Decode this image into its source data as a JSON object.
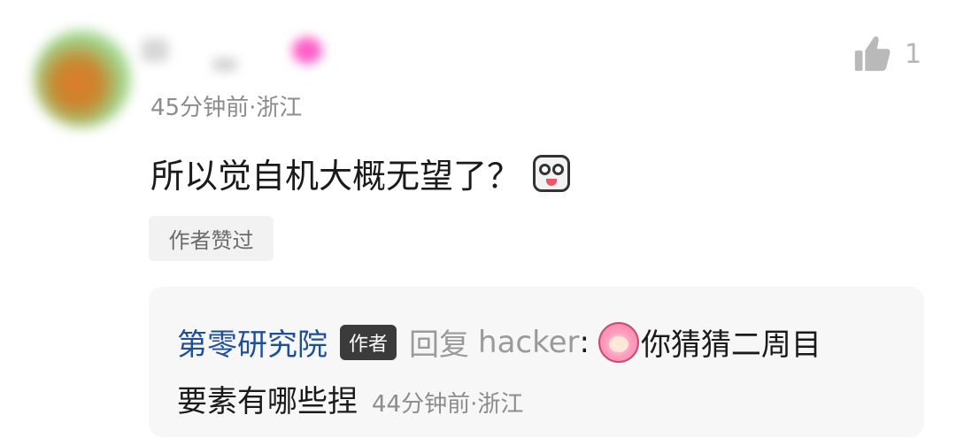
{
  "comment": {
    "meta": "45分钟前·浙江",
    "text": "所以觉自机大概无望了？",
    "like_count": "1",
    "author_liked_tag": "作者赞过"
  },
  "reply": {
    "author": "第零研究院",
    "badge": "作者",
    "reply_word": "回复",
    "target_user": "hacker",
    "colon": ":",
    "text_line1": "你猜猜二周目",
    "text_line2": "要素有哪些捏",
    "meta": "44分钟前·浙江"
  },
  "icons": {
    "like": "thumbs-up-icon",
    "comment_emoji": "surprised-face-emoji-icon",
    "reply_emoji": "anime-girl-emoji-icon"
  }
}
